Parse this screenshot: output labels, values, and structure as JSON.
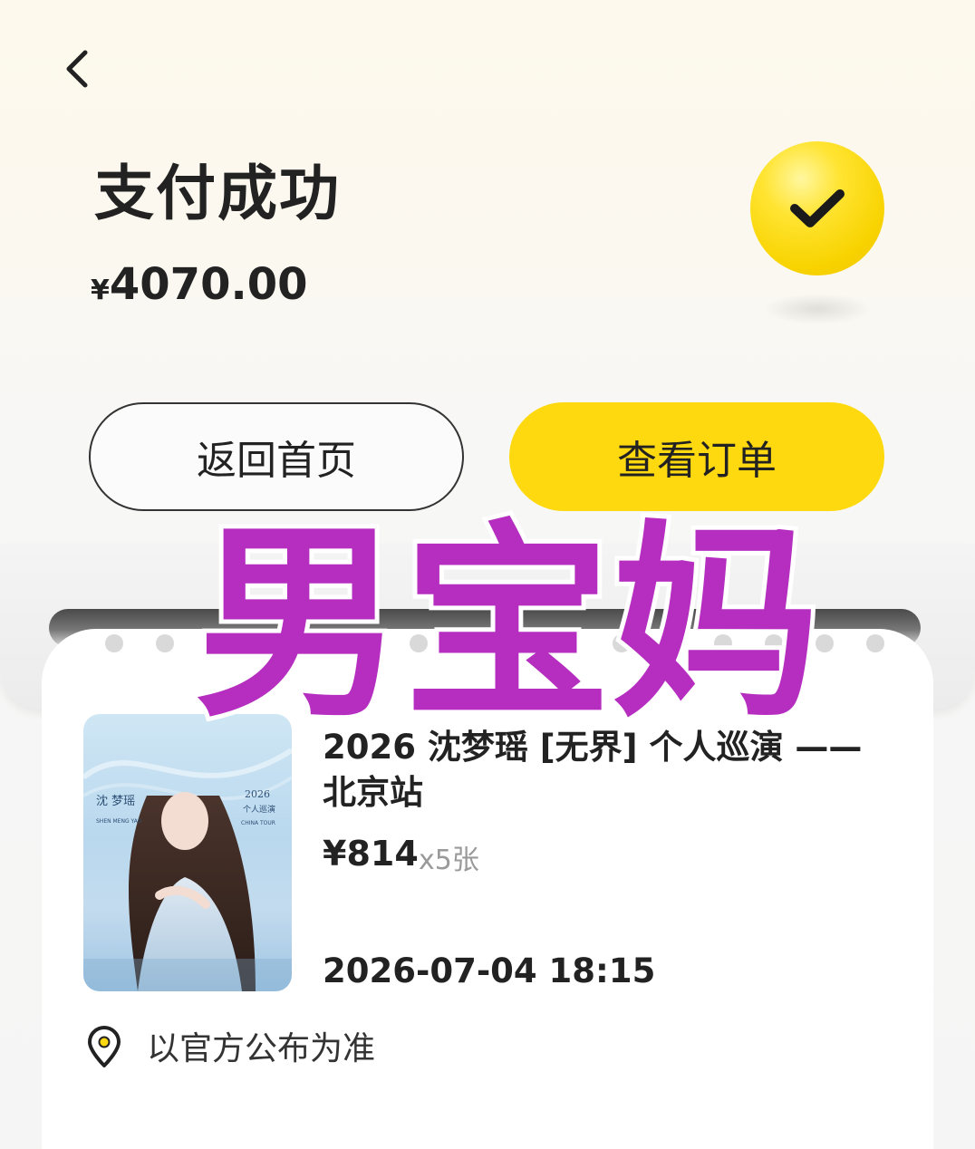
{
  "header": {
    "back_icon": "chevron-left-icon",
    "title": "支付成功",
    "currency_symbol": "¥",
    "amount": "4070.00",
    "status_icon": "checkmark-icon"
  },
  "actions": {
    "home_label": "返回首页",
    "order_label": "查看订单"
  },
  "order": {
    "event_title": "2026 沈梦瑶 [无界] 个人巡演 —— 北京站",
    "price": "¥814",
    "quantity": "x5张",
    "datetime": "2026-07-04 18:15",
    "venue_icon": "location-pin-icon",
    "venue": "以官方公布为准",
    "poster": {
      "name_cn": "沈 梦瑶",
      "name_en": "SHEN MENG YAO",
      "year": "2026",
      "tour_cn": "个人巡演",
      "tour_en": "CHINA TOUR"
    }
  },
  "watermark": "男宝妈",
  "colors": {
    "accent": "#ffd90f",
    "watermark_fill": "#b62ec0",
    "background": "#f5f5f5"
  }
}
